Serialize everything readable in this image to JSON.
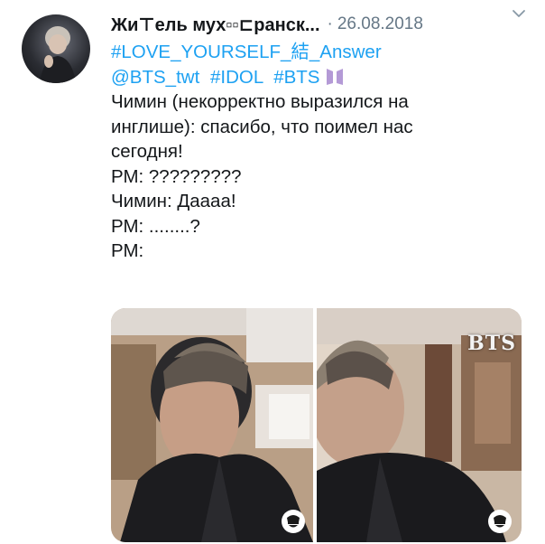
{
  "tweet": {
    "author_name": "Жи⊤ель мух▫▫⊏ранск...",
    "separator": "·",
    "date": "26.08.2018",
    "hashtag_line": "#LOVE_YOURSELF_結_Answer",
    "tags": [
      "@BTS_twt",
      "#IDOL",
      "#BTS"
    ],
    "body_lines": [
      "Чимин (некорректно выразился на",
      "инглише): спасибо, что поимел нас",
      "сегодня!",
      "РМ: ?????????",
      "Чимин: Даааа!",
      "РМ: ........?",
      "РМ:"
    ],
    "media": {
      "watermark": "BTS"
    }
  },
  "colors": {
    "link": "#1da1f2",
    "text": "#14171a",
    "muted": "#657786"
  },
  "icons": {
    "caret": "chevron-down-icon",
    "bts_emoji": "bts-logo-emoji",
    "badge": "channel-badge-icon"
  }
}
